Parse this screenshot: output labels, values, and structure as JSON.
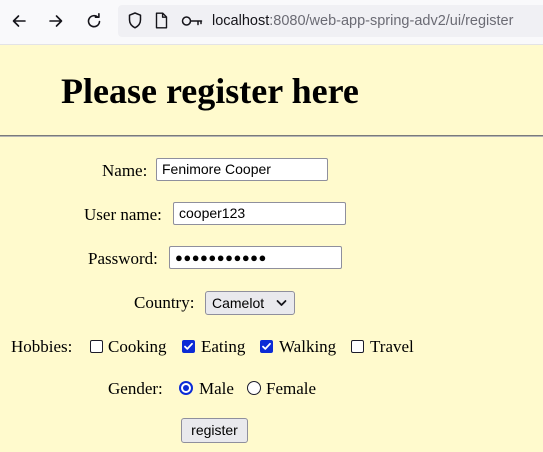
{
  "browser": {
    "icons": {
      "back": "arrow-left-icon",
      "forward": "arrow-right-icon",
      "reload": "reload-icon",
      "shield": "shield-icon",
      "page": "page-icon",
      "key": "key-icon"
    },
    "url": {
      "host": "localhost",
      "rest": ":8080/web-app-spring-adv2/ui/register"
    }
  },
  "page": {
    "background": "#fffacd",
    "heading": "Please register here"
  },
  "form": {
    "name_label": "Name:",
    "name_value": "Fenimore Cooper",
    "username_label": "User name:",
    "username_value": "cooper123",
    "password_label": "Password:",
    "password_masked": "●●●●●●●●●●●",
    "country_label": "Country:",
    "country_selected": "Camelot",
    "hobbies_label": "Hobbies:",
    "hobbies": [
      {
        "label": "Cooking",
        "checked": false
      },
      {
        "label": "Eating",
        "checked": true
      },
      {
        "label": "Walking",
        "checked": true
      },
      {
        "label": "Travel",
        "checked": false
      }
    ],
    "gender_label": "Gender:",
    "genders": [
      {
        "label": "Male",
        "checked": true
      },
      {
        "label": "Female",
        "checked": false
      }
    ],
    "submit_label": "register",
    "accent_color": "#0b2bd6"
  }
}
